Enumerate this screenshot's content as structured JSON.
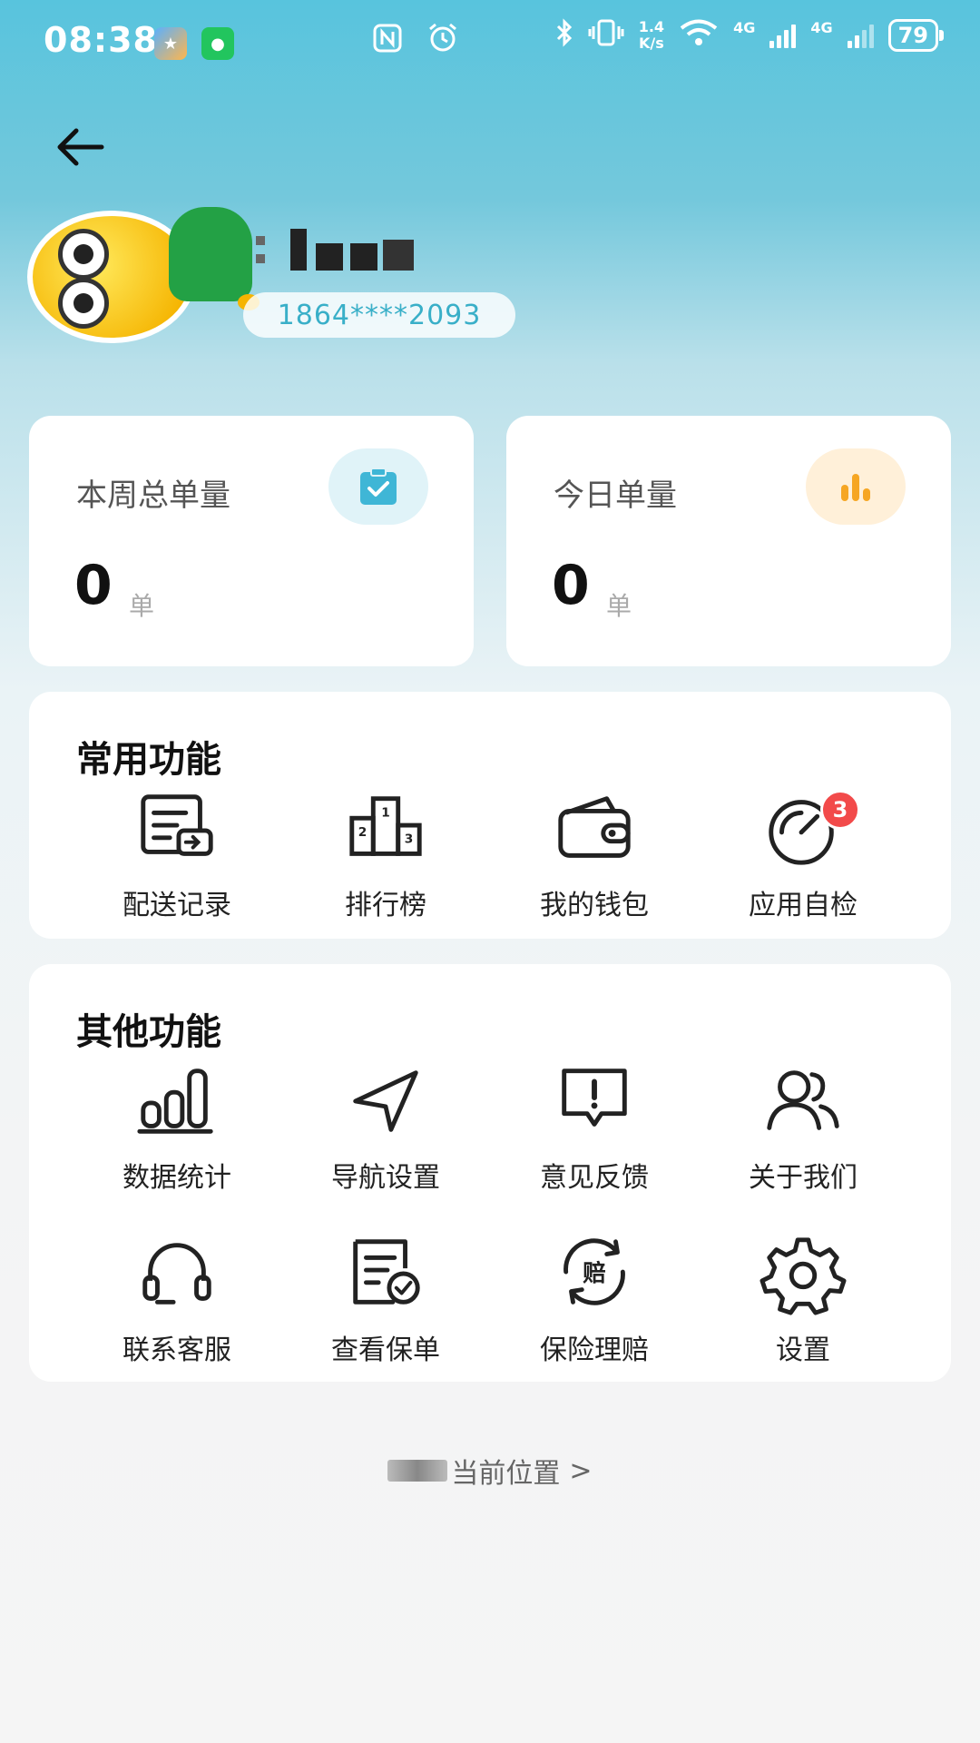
{
  "status_bar": {
    "time": "08:38",
    "network_speed_value": "1.4",
    "network_speed_unit": "K/s",
    "network_type_1": "4G",
    "network_type_2": "4G",
    "battery": "79",
    "icons": [
      "game-app-icon",
      "wechat-icon",
      "nfc-icon",
      "alarm-icon",
      "bluetooth-icon",
      "vibrate-icon",
      "wifi-icon",
      "signal-icon",
      "signal-icon",
      "battery-icon"
    ]
  },
  "header": {
    "back_icon": "arrow-left-icon",
    "phone": "1864****2093"
  },
  "stats": {
    "week_total": {
      "title": "本周总单量",
      "value": "0",
      "unit": "单",
      "icon": "clipboard-check-icon",
      "icon_color": "#3fb6d6"
    },
    "today": {
      "title": "今日单量",
      "value": "0",
      "unit": "单",
      "icon": "bar-chart-icon",
      "icon_color": "#f6a623"
    }
  },
  "common_functions": {
    "title": "常用功能",
    "items": [
      {
        "label": "配送记录",
        "icon": "delivery-record-icon"
      },
      {
        "label": "排行榜",
        "icon": "podium-icon"
      },
      {
        "label": "我的钱包",
        "icon": "wallet-icon"
      },
      {
        "label": "应用自检",
        "icon": "gauge-icon",
        "badge": "3"
      }
    ]
  },
  "other_functions": {
    "title": "其他功能",
    "items": [
      {
        "label": "数据统计",
        "icon": "data-stats-icon"
      },
      {
        "label": "导航设置",
        "icon": "navigation-arrow-icon"
      },
      {
        "label": "意见反馈",
        "icon": "feedback-icon"
      },
      {
        "label": "关于我们",
        "icon": "users-icon"
      },
      {
        "label": "联系客服",
        "icon": "headset-icon"
      },
      {
        "label": "查看保单",
        "icon": "policy-check-icon"
      },
      {
        "label": "保险理赔",
        "icon": "insurance-claim-icon"
      },
      {
        "label": "设置",
        "icon": "gear-icon"
      }
    ]
  },
  "footer": {
    "location_text": "当前位置",
    "chevron": ">"
  },
  "colors": {
    "accent_blue": "#3fb6d6",
    "accent_orange": "#f6a623",
    "badge_red": "#f24a4a"
  }
}
